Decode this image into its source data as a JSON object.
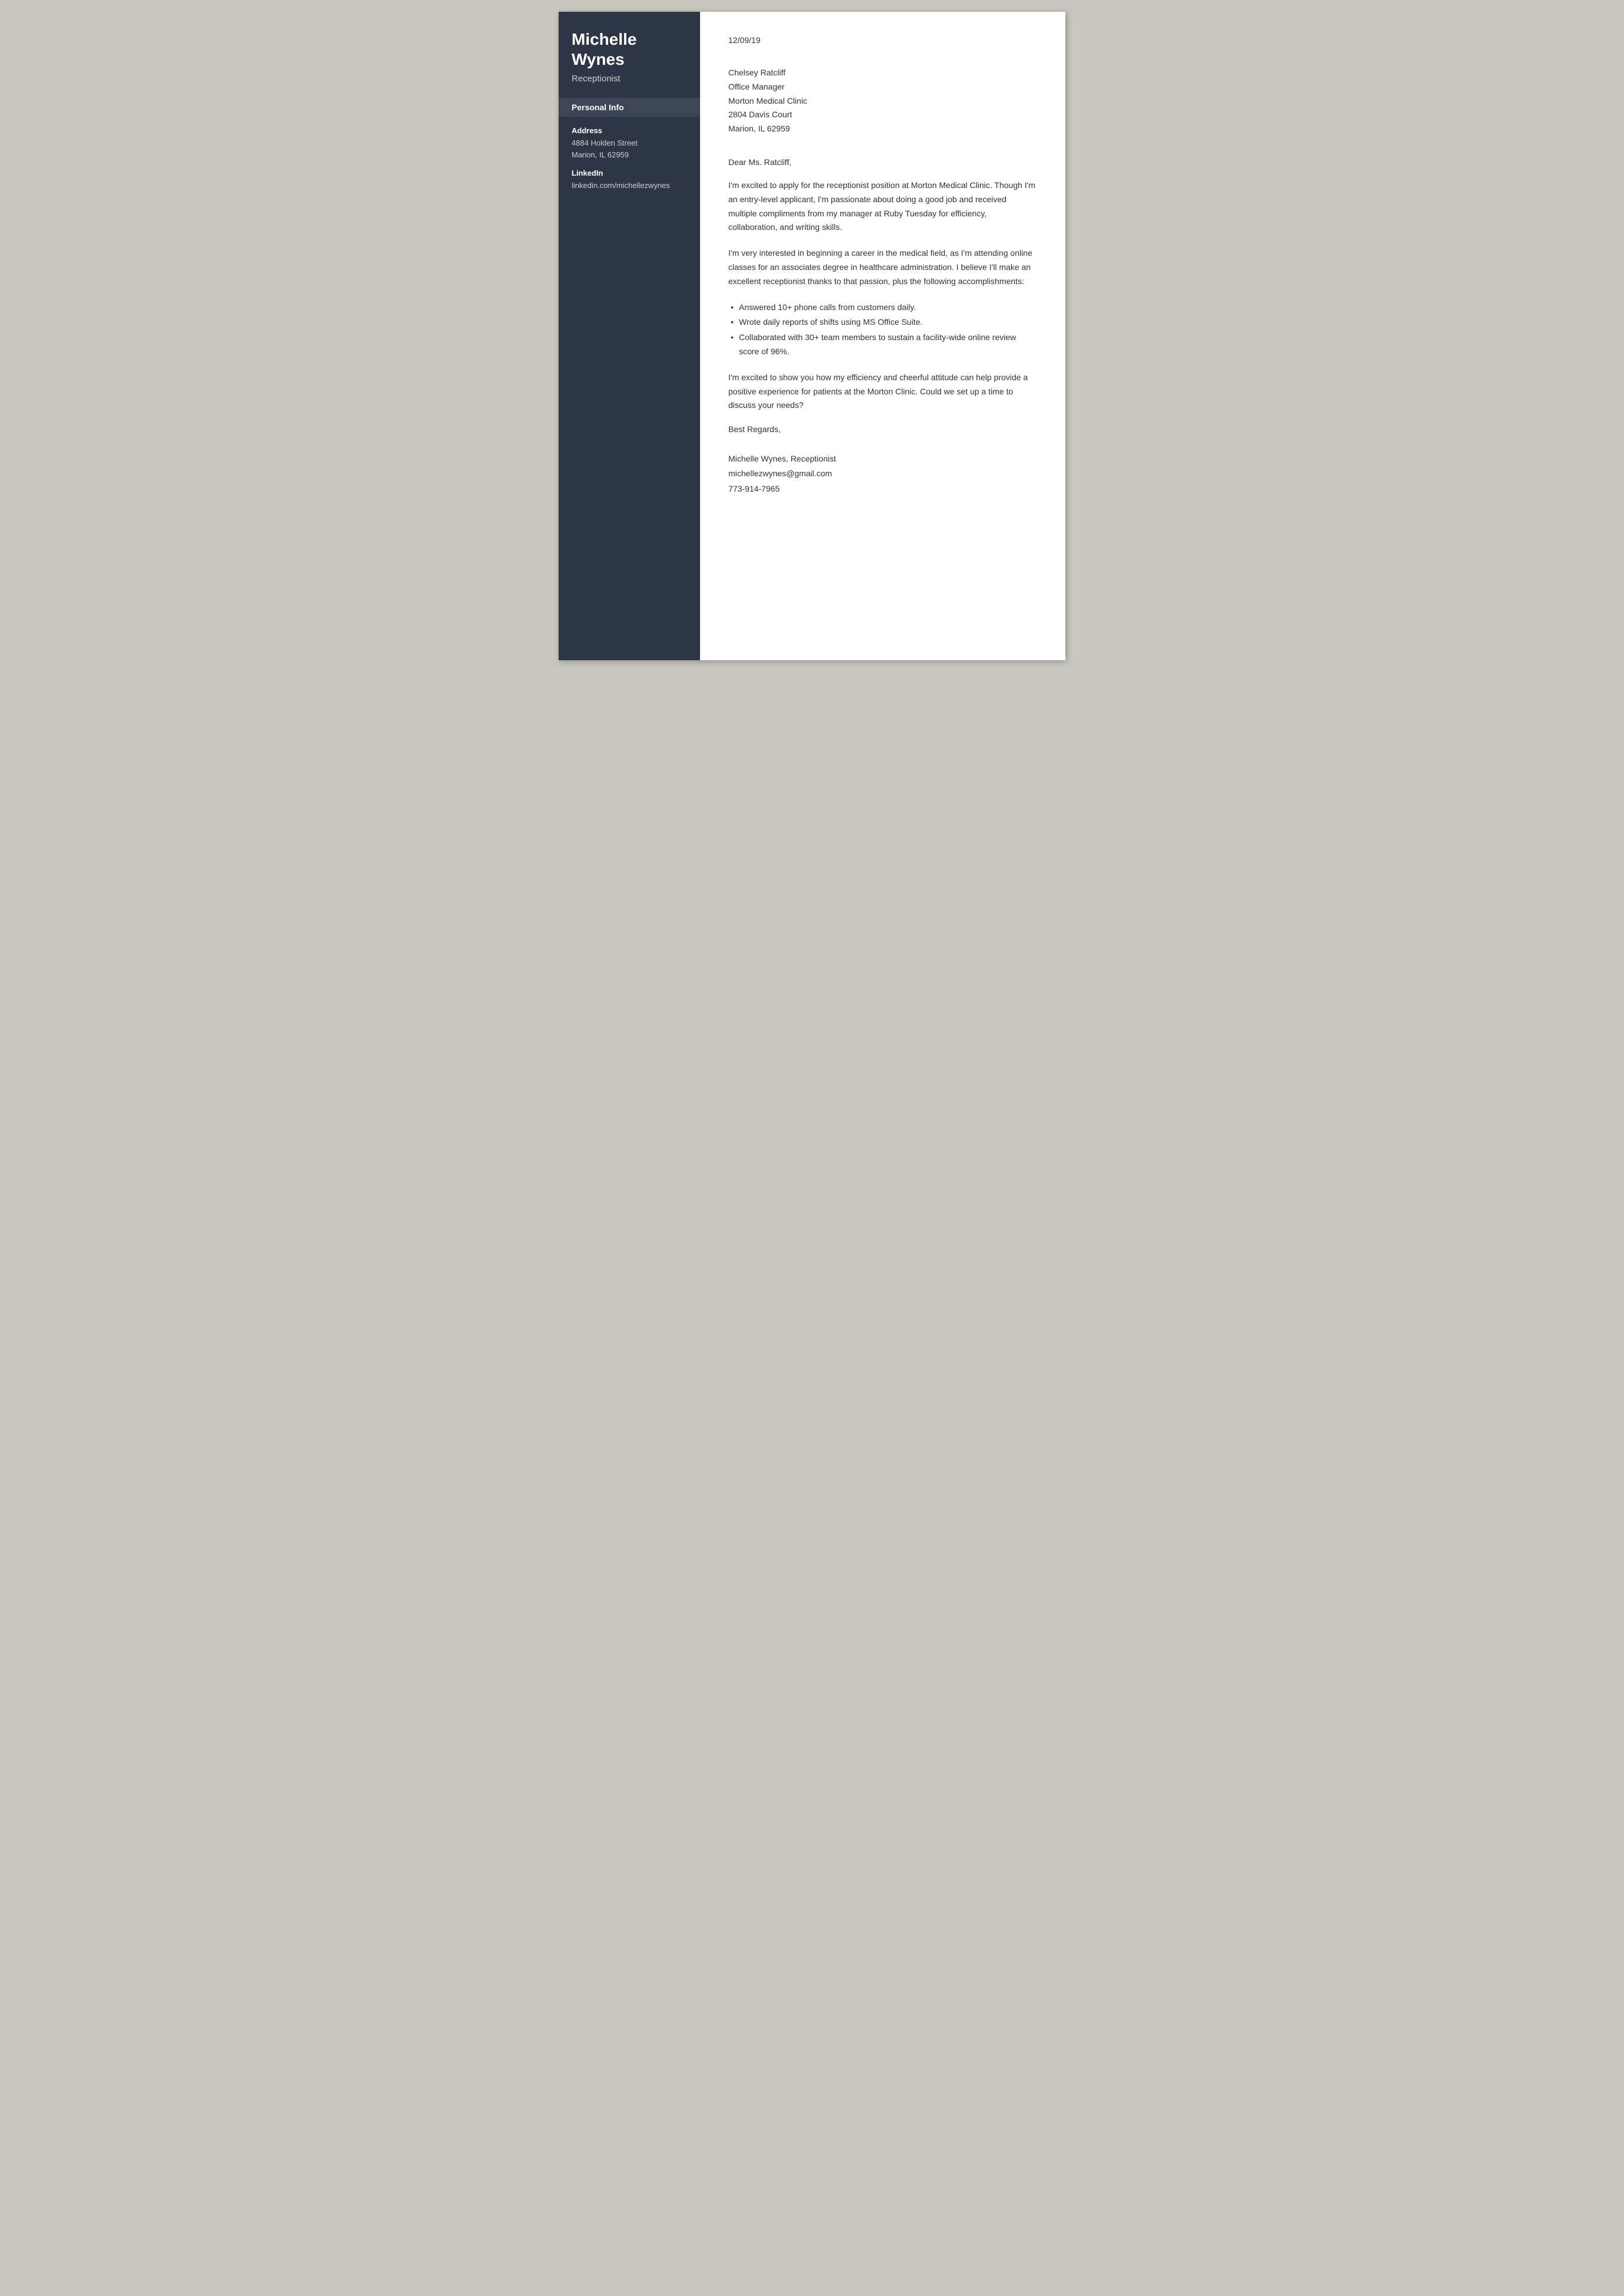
{
  "sidebar": {
    "name_line1": "Michelle",
    "name_line2": "Wynes",
    "title": "Receptionist",
    "personal_info_header": "Personal Info",
    "address_label": "Address",
    "address_line1": "4884 Holden Street",
    "address_line2": "Marion, IL 62959",
    "linkedin_label": "LinkedIn",
    "linkedin_value": "linkedin.com/michellezwynes"
  },
  "letter": {
    "date": "12/09/19",
    "recipient": {
      "name": "Chelsey Ratcliff",
      "title": "Office Manager",
      "company": "Morton Medical Clinic",
      "address1": "2804 Davis Court",
      "city_state_zip": "Marion, IL 62959"
    },
    "salutation": "Dear Ms. Ratcliff,",
    "paragraph1": "I'm excited to apply for the receptionist position at Morton Medical Clinic. Though I'm an entry-level applicant, I'm passionate about doing a good job and received multiple compliments from my manager at Ruby Tuesday for efficiency, collaboration, and writing skills.",
    "paragraph2": "I'm very interested in beginning a career in the medical field, as I'm attending online classes for an associates degree in healthcare administration. I believe I'll make an excellent receptionist thanks to that passion, plus the following accomplishments:",
    "bullet1": "Answered 10+ phone calls from customers daily.",
    "bullet2": "Wrote daily reports of shifts using MS Office Suite.",
    "bullet3": "Collaborated with 30+ team members to sustain a facility-wide online review score of 96%.",
    "paragraph3": "I'm excited to show you how my efficiency and cheerful attitude can help provide a positive experience for patients at the Morton Clinic. Could we set up a time to discuss your needs?",
    "closing": "Best Regards,",
    "signature_name": "Michelle Wynes, Receptionist",
    "signature_email": "michellezwynes@gmail.com",
    "signature_phone": "773-914-7965"
  }
}
